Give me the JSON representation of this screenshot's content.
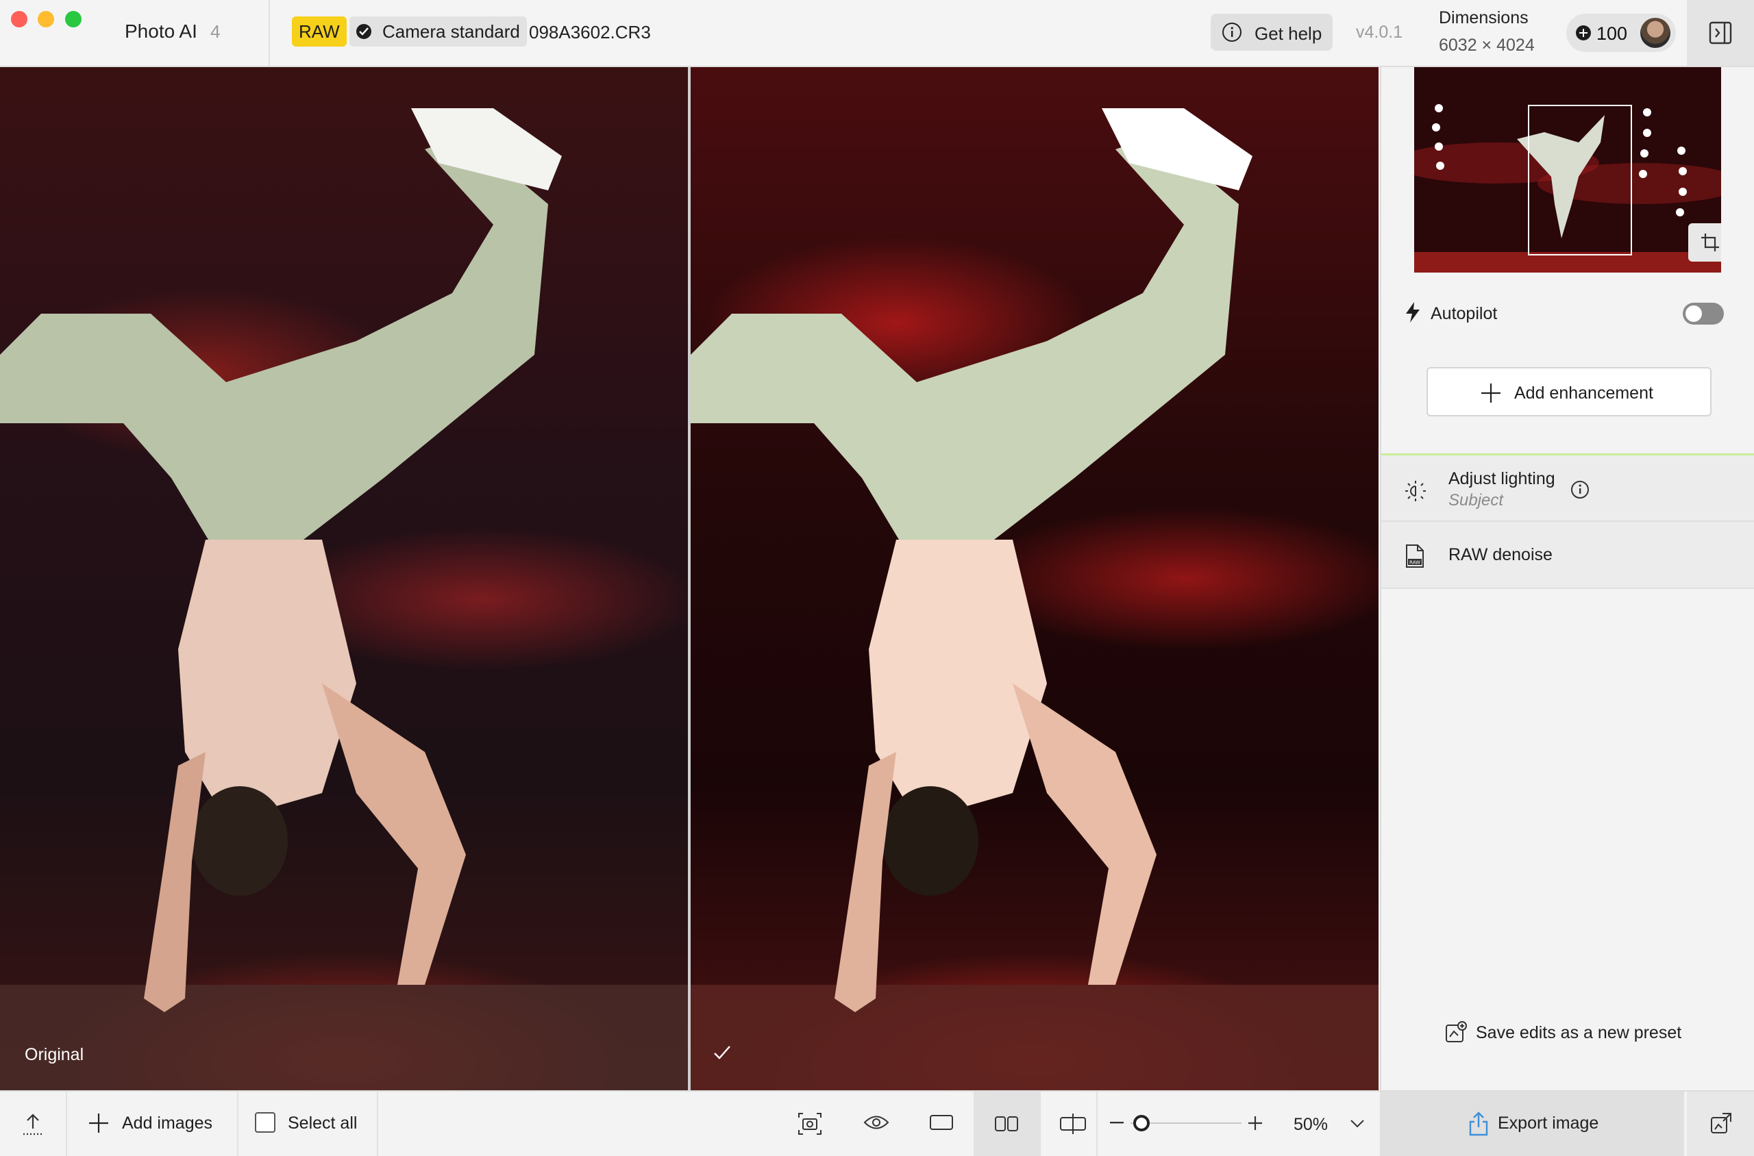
{
  "window": {
    "app_name": "Photo AI",
    "app_version_badge": "4"
  },
  "header": {
    "raw_badge": "RAW",
    "profile_badge": "Camera standard",
    "filename": "098A3602.CR3",
    "help_label": "Get help",
    "version": "v4.0.1",
    "dimensions_label": "Dimensions",
    "dimensions_value": "6032 × 4024",
    "credits": "100"
  },
  "viewer": {
    "original_label": "Original",
    "left_icon": "none",
    "right_icon": "checkmark-icon"
  },
  "sidepanel": {
    "autopilot_label": "Autopilot",
    "autopilot_enabled": false,
    "add_enhancement_label": "Add enhancement",
    "enhancements": [
      {
        "title": "Adjust lighting",
        "subtitle": "Subject",
        "icon": "lighting-icon"
      },
      {
        "title": "RAW denoise",
        "icon": "raw-file-icon"
      }
    ],
    "save_preset_label": "Save edits as a new preset"
  },
  "bottombar": {
    "add_images_label": "Add images",
    "select_all_label": "Select all",
    "zoom_value": "50%",
    "export_label": "Export image",
    "active_view": "side-by-side"
  },
  "colors": {
    "raw_badge": "#f7d01a",
    "accent_line": "#c9ef9a",
    "traffic_red": "#fe5f57",
    "traffic_yellow": "#febc2e",
    "traffic_green": "#28c840"
  }
}
